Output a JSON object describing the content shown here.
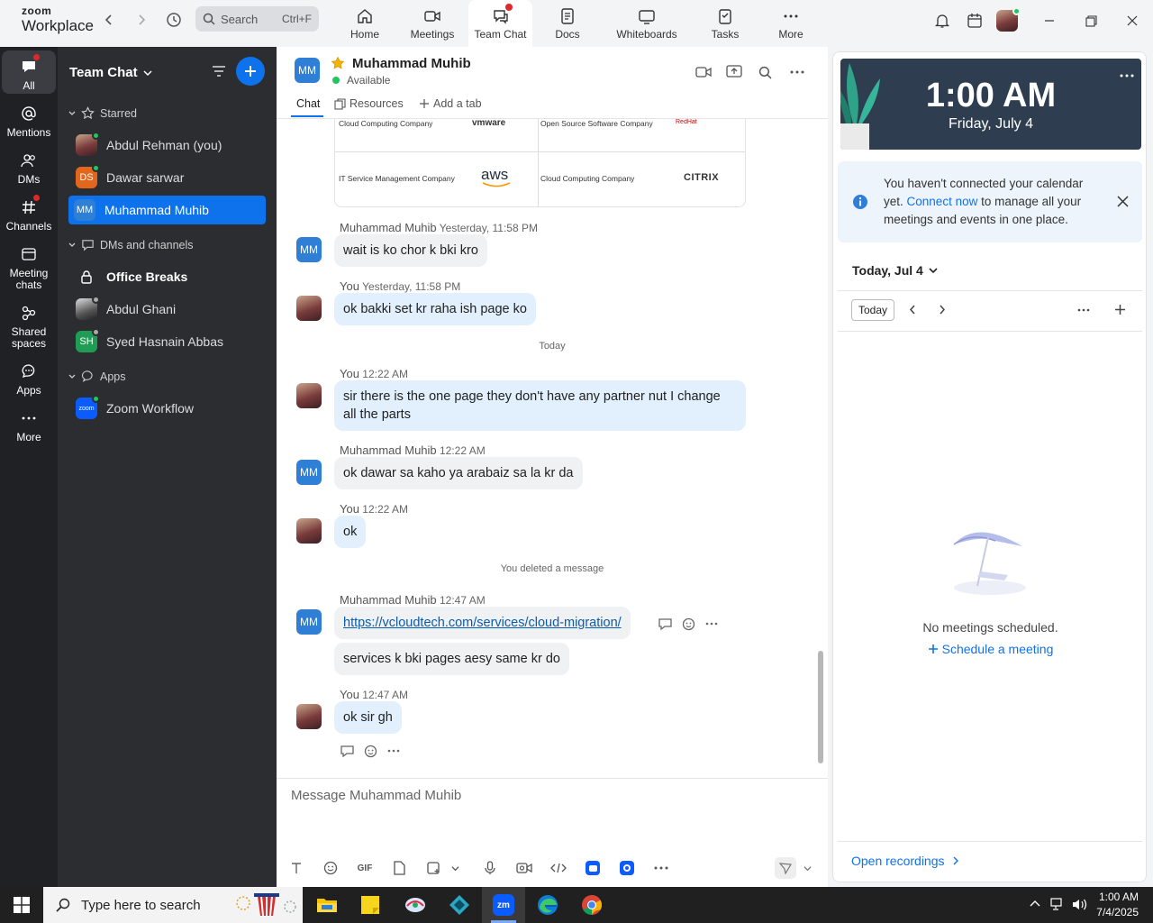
{
  "app": {
    "brand_top": "zoom",
    "brand_bottom": "Workplace"
  },
  "search": {
    "label": "Search",
    "shortcut": "Ctrl+F"
  },
  "tabs": [
    {
      "label": "Home",
      "icon": "home-icon"
    },
    {
      "label": "Meetings",
      "icon": "video-icon"
    },
    {
      "label": "Team Chat",
      "icon": "chat-icon"
    },
    {
      "label": "Docs",
      "icon": "doc-icon"
    },
    {
      "label": "Whiteboards",
      "icon": "whiteboard-icon"
    },
    {
      "label": "Tasks",
      "icon": "tasks-icon"
    },
    {
      "label": "More",
      "icon": "more-icon"
    }
  ],
  "rail": [
    {
      "label": "All"
    },
    {
      "label": "Mentions"
    },
    {
      "label": "DMs"
    },
    {
      "label": "Channels"
    },
    {
      "label": "Meeting chats"
    },
    {
      "label": "Shared spaces"
    },
    {
      "label": "Apps"
    },
    {
      "label": "More"
    }
  ],
  "sidebar": {
    "title": "Team Chat",
    "starred_label": "Starred",
    "starred": [
      {
        "name": "Abdul Rehman (you)",
        "initials": ""
      },
      {
        "name": "Dawar sarwar",
        "initials": "DS"
      },
      {
        "name": "Muhammad Muhib",
        "initials": "MM"
      }
    ],
    "dms_label": "DMs and channels",
    "dms": [
      {
        "name": "Office Breaks"
      },
      {
        "name": "Abdul Ghani"
      },
      {
        "name": "Syed Hasnain Abbas",
        "initials": "SH"
      }
    ],
    "apps_label": "Apps",
    "apps": [
      {
        "name": "Zoom Workflow",
        "initials": "zoom"
      }
    ]
  },
  "chat": {
    "name": "Muhammad Muhib",
    "initials": "MM",
    "status": "Available",
    "tabs": {
      "chat": "Chat",
      "resources": "Resources",
      "add": "Add a tab"
    },
    "logo_card": {
      "row1_left_label": "Cloud Computing Company",
      "row1_left_logo": "vmware",
      "row1_right_label": "Open Source Software Company",
      "row1_right_logo": "RedHat",
      "row2_left_label": "IT Service Management Company",
      "row2_left_logo": "aws",
      "row2_right_label": "Cloud Computing Company",
      "row2_right_logo": "CITRIX"
    },
    "messages": [
      {
        "sender": "Muhammad Muhib",
        "time": "Yesterday, 11:58 PM",
        "text": "wait is ko chor k bki kro"
      },
      {
        "sender": "You",
        "time": "Yesterday, 11:58 PM",
        "text": "ok bakki set kr raha ish page ko"
      },
      {
        "divider": "Today"
      },
      {
        "sender": "You",
        "time": "12:22 AM",
        "text": "sir there is the one page they don't have any partner nut I change all the parts"
      },
      {
        "sender": "Muhammad Muhib",
        "time": "12:22 AM",
        "text": "ok dawar sa kaho ya arabaiz sa la kr da"
      },
      {
        "sender": "You",
        "time": "12:22 AM",
        "text": "ok"
      },
      {
        "note": "You deleted a message"
      },
      {
        "sender": "Muhammad Muhib",
        "time": "12:47 AM",
        "link": "https://vcloudtech.com/services/cloud-migration/",
        "text": "services k bki pages aesy same kr do"
      },
      {
        "sender": "You",
        "time": "12:47 AM",
        "text": "ok sir gh"
      }
    ],
    "compose_placeholder": "Message Muhammad Muhib",
    "gif_label": "GIF"
  },
  "right": {
    "time": "1:00 AM",
    "date": "Friday, July 4",
    "notice_pre": "You haven't connected your calendar yet.",
    "notice_link": "Connect now",
    "notice_post": "to manage all your meetings and events in one place.",
    "cal_date": "Today, Jul 4",
    "today_btn": "Today",
    "empty": "No meetings scheduled.",
    "schedule": "Schedule a meeting",
    "open_recordings": "Open recordings"
  },
  "taskbar": {
    "search": "Type here to search",
    "time": "1:00 AM",
    "date": "7/4/2025"
  },
  "colors": {
    "accent": "#0e72ed",
    "rail": "#1f2125",
    "sidebar": "#2b2d31",
    "bubble_me": "#e2f0fd",
    "bubble_other": "#f0f1f3"
  }
}
